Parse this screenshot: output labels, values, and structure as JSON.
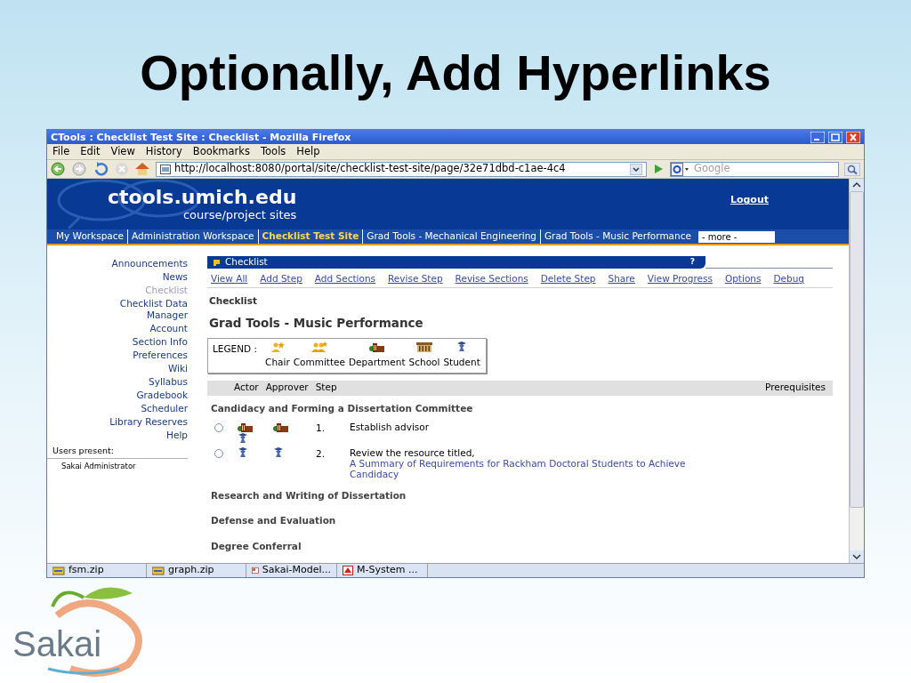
{
  "slide": {
    "title": "Optionally, Add Hyperlinks",
    "logo_text": "Sakai"
  },
  "window": {
    "title": "CTools : Checklist Test Site : Checklist - Mozilla Firefox"
  },
  "menu": [
    "File",
    "Edit",
    "View",
    "History",
    "Bookmarks",
    "Tools",
    "Help"
  ],
  "address": {
    "value": "http://localhost:8080/portal/site/checklist-test-site/page/32e71dbd-c1ae-4c4"
  },
  "search": {
    "placeholder": "Google"
  },
  "banner": {
    "site": "ctools.umich.edu",
    "subtitle": "course/project sites",
    "logout": "Logout"
  },
  "site_tabs": [
    {
      "label": "My Workspace",
      "selected": false
    },
    {
      "label": "Administration Workspace",
      "selected": false
    },
    {
      "label": "Checklist Test Site",
      "selected": true
    },
    {
      "label": "Grad Tools - Mechanical Engineering",
      "selected": false
    },
    {
      "label": "Grad Tools - Music Performance",
      "selected": false
    }
  ],
  "more": "- more -",
  "tool_menu": [
    {
      "label": "Announcements",
      "selected": false
    },
    {
      "label": "News",
      "selected": false
    },
    {
      "label": "Checklist",
      "selected": true
    },
    {
      "label": "Checklist Data Manager",
      "selected": false
    },
    {
      "label": "Account",
      "selected": false
    },
    {
      "label": "Section Info",
      "selected": false
    },
    {
      "label": "Preferences",
      "selected": false
    },
    {
      "label": "Wiki",
      "selected": false
    },
    {
      "label": "Syllabus",
      "selected": false
    },
    {
      "label": "Gradebook",
      "selected": false
    },
    {
      "label": "Scheduler",
      "selected": false
    },
    {
      "label": "Library Reserves",
      "selected": false
    },
    {
      "label": "Help",
      "selected": false
    }
  ],
  "users_present": {
    "label": "Users present:",
    "users": [
      "Sakai Administrator"
    ]
  },
  "tool": {
    "title": "Checklist",
    "help": "?",
    "actions": [
      "View All",
      "Add Step",
      "Add Sections",
      "Revise Step",
      "Revise Sections",
      "Delete Step",
      "Share",
      "View Progress",
      "Options",
      "Debug"
    ],
    "heading": "Checklist",
    "subtitle": "Grad Tools - Music Performance",
    "legend": {
      "label": "LEGEND :",
      "items": [
        {
          "label": "Chair",
          "kind": "chair"
        },
        {
          "label": "Committee",
          "kind": "committee"
        },
        {
          "label": "Department",
          "kind": "department"
        },
        {
          "label": "School",
          "kind": "school"
        },
        {
          "label": "Student",
          "kind": "student"
        }
      ]
    },
    "columns": [
      "Actor",
      "Approver",
      "Step",
      "Prerequisites"
    ],
    "sections": [
      {
        "title": "Candidacy and Forming a Dissertation Committee",
        "steps": [
          {
            "checked": false,
            "actors": [
              {
                "kind": "department"
              },
              {
                "kind": "student"
              }
            ],
            "approvers": [
              {
                "kind": "department"
              }
            ],
            "number": "1.",
            "text": "Establish advisor"
          },
          {
            "checked": false,
            "actors": [
              {
                "kind": "student"
              }
            ],
            "approvers": [
              {
                "kind": "student"
              }
            ],
            "number": "2.",
            "text": "Review the resource titled, ",
            "link": "A Summary of Requirements for Rackham Doctoral Students to Achieve Candidacy"
          }
        ]
      },
      {
        "title": "Research and Writing of Dissertation"
      },
      {
        "title": "Defense and Evaluation"
      },
      {
        "title": "Degree Conferral"
      }
    ]
  },
  "downloads": [
    {
      "label": "fsm.zip",
      "kind": "archive"
    },
    {
      "label": "graph.zip",
      "kind": "archive"
    },
    {
      "label": "Sakai-Model...",
      "kind": "slides"
    },
    {
      "label": "M-System ...",
      "kind": "pdf"
    }
  ]
}
